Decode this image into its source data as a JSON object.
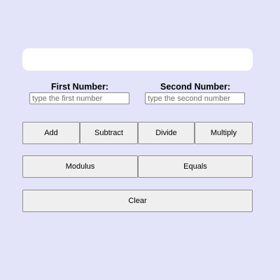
{
  "display": {
    "value": ""
  },
  "inputs": {
    "first": {
      "label": "First Number:",
      "placeholder": "type the first number",
      "value": ""
    },
    "second": {
      "label": "Second Number:",
      "placeholder": "type the second number",
      "value": ""
    }
  },
  "buttons": {
    "add": "Add",
    "subtract": "Subtract",
    "divide": "Divide",
    "multiply": "Multiply",
    "modulus": "Modulus",
    "equals": "Equals",
    "clear": "Clear"
  },
  "colors": {
    "background": "#e3e3f9",
    "display": "#ffffff",
    "button": "#efefef"
  }
}
